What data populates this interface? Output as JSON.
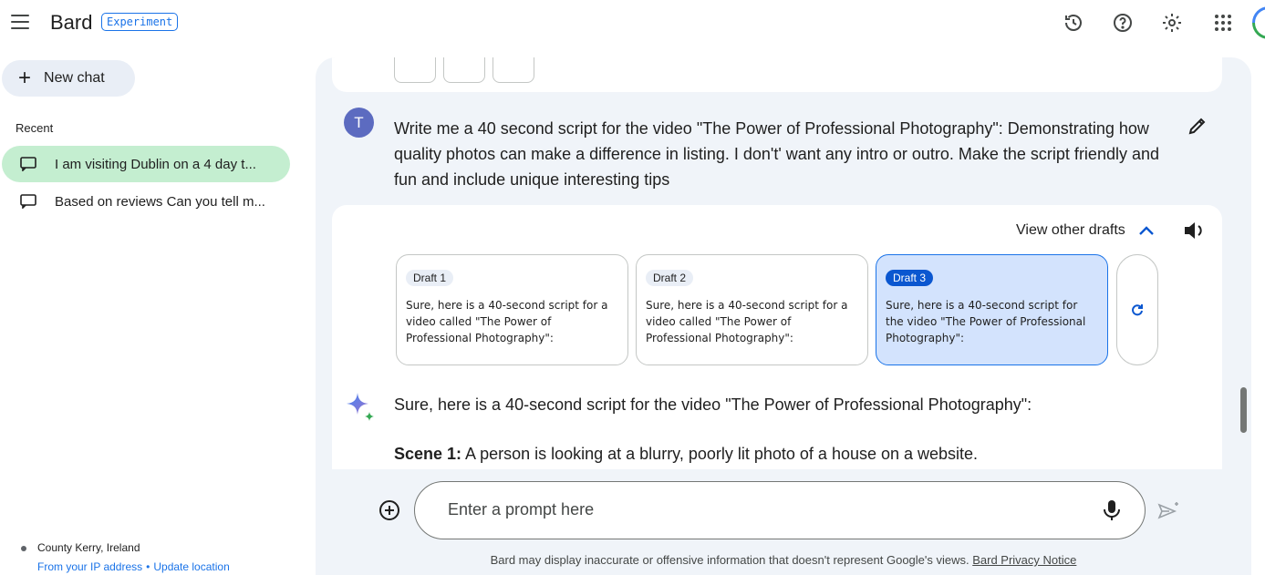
{
  "header": {
    "brand": "Bard",
    "badge": "Experiment"
  },
  "sidebar": {
    "new_chat": "New chat",
    "recent_label": "Recent",
    "items": [
      {
        "label": "I am visiting Dublin on a 4 day t...",
        "active": true
      },
      {
        "label": "Based on reviews Can you tell m...",
        "active": false
      }
    ],
    "location": "County Kerry, Ireland",
    "location_source": "From your IP address",
    "location_separator": "•",
    "update_location": "Update location"
  },
  "conversation": {
    "user_initial": "T",
    "user_prompt": "Write me a 40 second script for  the video \"The Power of Professional Photography\": Demonstrating how quality photos can make a difference in listing. I don't' want any intro or outro. Make the script friendly and fun and include  unique interesting tips",
    "view_other_drafts": "View other drafts",
    "drafts": [
      {
        "label": "Draft 1",
        "text": "Sure, here is a 40-second script for a video called \"The Power of Professional Photography\":",
        "selected": false
      },
      {
        "label": "Draft 2",
        "text": "Sure, here is a 40-second script for a video called \"The Power of Professional Photography\":",
        "selected": false
      },
      {
        "label": "Draft 3",
        "text": "Sure, here is a 40-second script for the video \"The Power of Professional Photography\":",
        "selected": true
      }
    ],
    "response_intro": "Sure, here is a 40-second script for the video \"The Power of Professional Photography\":",
    "scene_label": "Scene 1:",
    "scene_text": " A person is looking at a blurry, poorly lit photo of a house on a website."
  },
  "composer": {
    "placeholder": "Enter a prompt here",
    "disclaimer": "Bard may display inaccurate or offensive information that doesn't represent Google's views. ",
    "privacy_link": "Bard Privacy Notice"
  },
  "colors": {
    "accent": "#1a73e8",
    "active_item": "#c4eed0",
    "panel": "#f0f4f9",
    "selected_draft": "#d3e3fd"
  }
}
